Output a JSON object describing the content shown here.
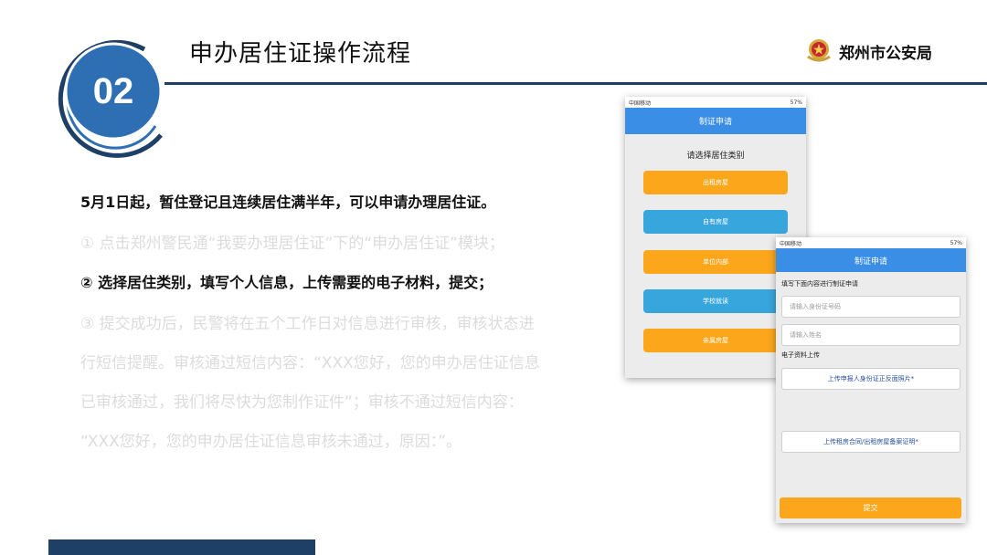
{
  "header": {
    "section_number": "02",
    "title": "申办居住证操作流程",
    "org_name": "郑州市公安局"
  },
  "colors": {
    "navy": "#1e3f66",
    "badge_blue": "#2e6fb3",
    "app_blue": "#3a8ee6",
    "orange": "#fba61b",
    "light_blue": "#37a6dc"
  },
  "content": {
    "intro": "5月1日起，暂住登记且连续居住满半年，可以申请办理居住证。",
    "step1": "① 点击郑州警民通“我要办理居住证”下的“申办居住证”模块；",
    "step2": "②  选择居住类别，填写个人信息，上传需要的电子材料，提交；",
    "step3_line1": "③  提交成功后，民警将在五个工作日对信息进行审核，审核状态进",
    "step3_line2": "行短信提醒。审核通过短信内容：“XXX您好，您的申办居住证信息",
    "step3_line3": "已审核通过，我们将尽快为您制作证件”；审核不通过短信内容：",
    "step3_line4": "“XXX您好，您的申办居住证信息审核未通过，原因：”。"
  },
  "phone1": {
    "status_left": "中国移动",
    "status_right": "57%",
    "header": "制证申请",
    "subtitle": "请选择居住类别",
    "options": [
      "出租房屋",
      "自有房屋",
      "单位内部",
      "学校就读",
      "亲属房屋"
    ]
  },
  "phone2": {
    "status_left": "中国移动",
    "status_right": "57%",
    "header": "制证申请",
    "form_hint": "填写下面内容进行制证申请",
    "id_placeholder": "请输入身份证号码",
    "name_placeholder": "请输入姓名",
    "upload_section": "电子资料上传",
    "upload_id": "上传申报人身份证正反面照片*",
    "upload_contract": "上传租房合同/出租房屋备案证明*",
    "submit": "提交"
  }
}
